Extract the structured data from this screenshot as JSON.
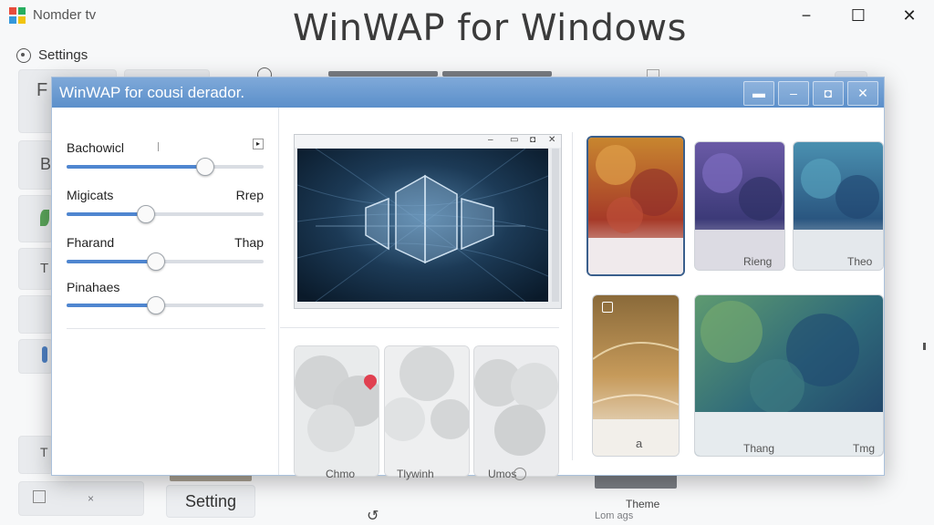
{
  "app": {
    "title": "Nomder tv"
  },
  "window": {
    "big_title": "WinWAP for Windows",
    "minimize": "−",
    "maximize": "☐",
    "close": "✕"
  },
  "sidebar": {
    "settings_label": "Settings",
    "ghost_letters": [
      "F",
      "B",
      "T",
      "T"
    ]
  },
  "bottom": {
    "setting_button": "Setting",
    "theme_label": "Theme",
    "bottom_faint": "Lom ags"
  },
  "dialog": {
    "title": "WinWAP for cousi derador.",
    "buttons": {
      "b1": "▬",
      "b2": "–",
      "b3": "◘",
      "close": "✕"
    },
    "sliders": [
      {
        "label": "Bachowicl",
        "right": "",
        "value": 0.7
      },
      {
        "label": "Migicats",
        "right": "Rrep",
        "value": 0.4
      },
      {
        "label": "Fharand",
        "right": "Thap",
        "value": 0.45
      },
      {
        "label": "Pinahaes",
        "right": "",
        "value": 0.45
      }
    ],
    "slider_corner_icon": "flag-icon",
    "bottom_thumb_labels": [
      "Chmo",
      "Tlywinh",
      "Umos"
    ],
    "theme_labels": [
      "Rieng",
      "Theo",
      "a",
      "Thang",
      "Tmg"
    ]
  },
  "colors": {
    "accent": "#4f86d0",
    "titlebar": "#6b9bd1"
  }
}
